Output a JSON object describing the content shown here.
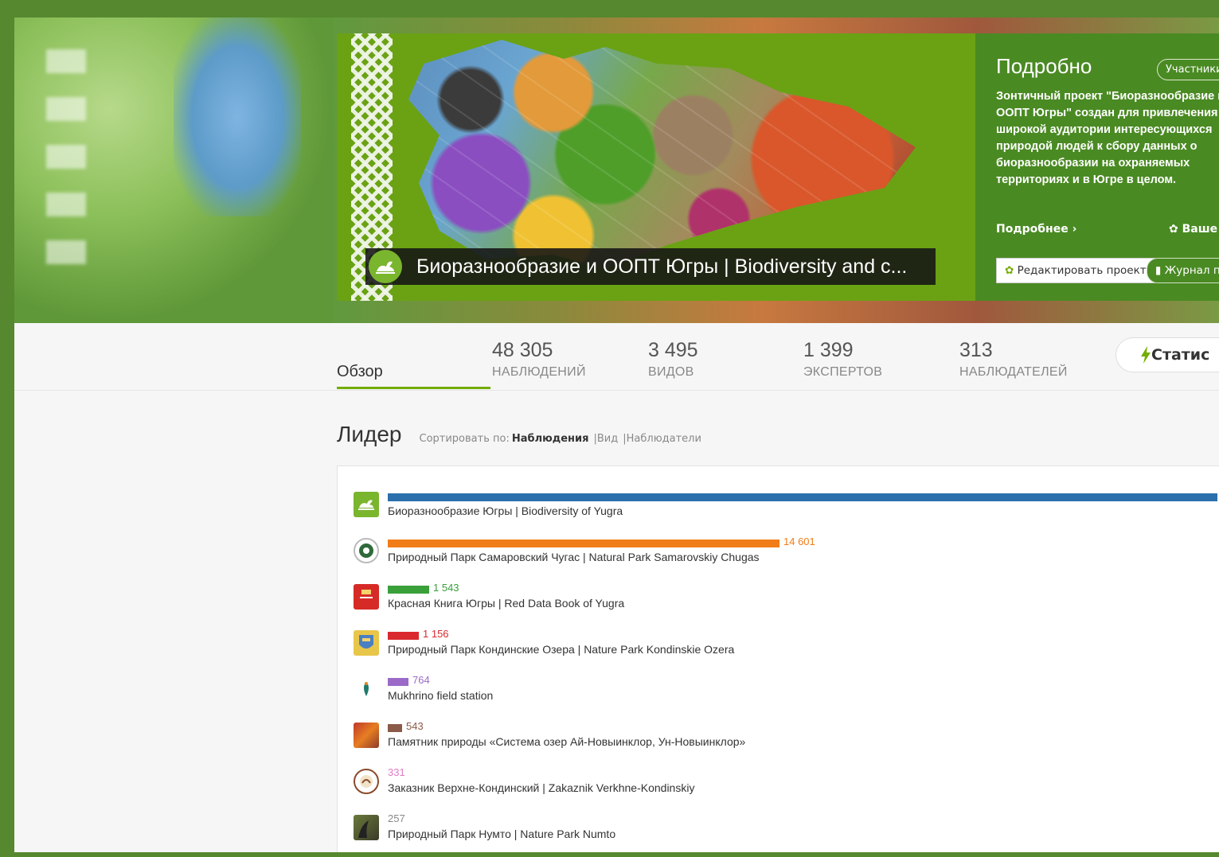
{
  "banner": {
    "project_title": "Биоразнообразие и ООПТ Югры | Biodiversity and c...",
    "details_title": "Подробно",
    "members_button": "Участники",
    "description": "Зонтичный проект \"Биоразнообразие и ООПТ Югры\" создан для привлечения широкой аудитории интересующихся природой людей к сбору данных о биоразнообразии на охраняемых территориях и в Югре в целом.",
    "more_link": "Подробнее ›",
    "yours_link": "Ваше у",
    "edit_button": "Редактировать проект",
    "journal_button": "Журнал п"
  },
  "nav": {
    "overview_tab": "Обзор",
    "stats": [
      {
        "num": "48 305",
        "label": "НАБЛЮДЕНИЙ"
      },
      {
        "num": "3 495",
        "label": "ВИДОВ"
      },
      {
        "num": "1 399",
        "label": "ЭКСПЕРТОВ"
      },
      {
        "num": "313",
        "label": "НАБЛЮДАТЕЛЕЙ"
      }
    ],
    "statistics_button": "Статис"
  },
  "leaders": {
    "title": "Лидер",
    "sort_label": "Сортировать по:",
    "sort_options": [
      "Наблюдения",
      "|Вид",
      "|Наблюдатели"
    ],
    "rows": [
      {
        "name": "Биоразнообразие Югры | Biodiversity of Yugra",
        "count": "",
        "value": 30900,
        "color": "#2c6fad",
        "icon": "yugra-logo-icon"
      },
      {
        "name": "Природный Парк Самаровский Чугас | Natural Park Samarovskiy Chugas",
        "count": "14 601",
        "value": 14601,
        "color": "#f17d18",
        "icon": "samarovskiy-logo-icon"
      },
      {
        "name": "Красная Книга Югры | Red Data Book of Yugra",
        "count": "1 543",
        "value": 1543,
        "color": "#3aa03a",
        "icon": "red-book-icon"
      },
      {
        "name": "Природный Парк Кондинские Озера | Nature Park Kondinskie Ozera",
        "count": "1 156",
        "value": 1156,
        "color": "#d9292f",
        "icon": "kondinskie-logo-icon"
      },
      {
        "name": "Mukhrino field station",
        "count": "764",
        "value": 764,
        "color": "#9b6ac9",
        "icon": "mukhrino-logo-icon"
      },
      {
        "name": "Памятник природы «Система озер Ай-Новыинклор, Ун-Новыинклор»",
        "count": "543",
        "value": 543,
        "color": "#8b5a48",
        "icon": "lakes-photo-icon"
      },
      {
        "name": "Заказник Верхне-Кондинский | Zakaznik Verkhne-Kondinskiy",
        "count": "331",
        "value": 331,
        "color": "#e27bc2",
        "icon": "zakaznik-logo-icon"
      },
      {
        "name": "Природный Парк Нумто | Nature Park Numto",
        "count": "257",
        "value": 257,
        "color": "#888888",
        "icon": "numto-photo-icon"
      }
    ]
  }
}
